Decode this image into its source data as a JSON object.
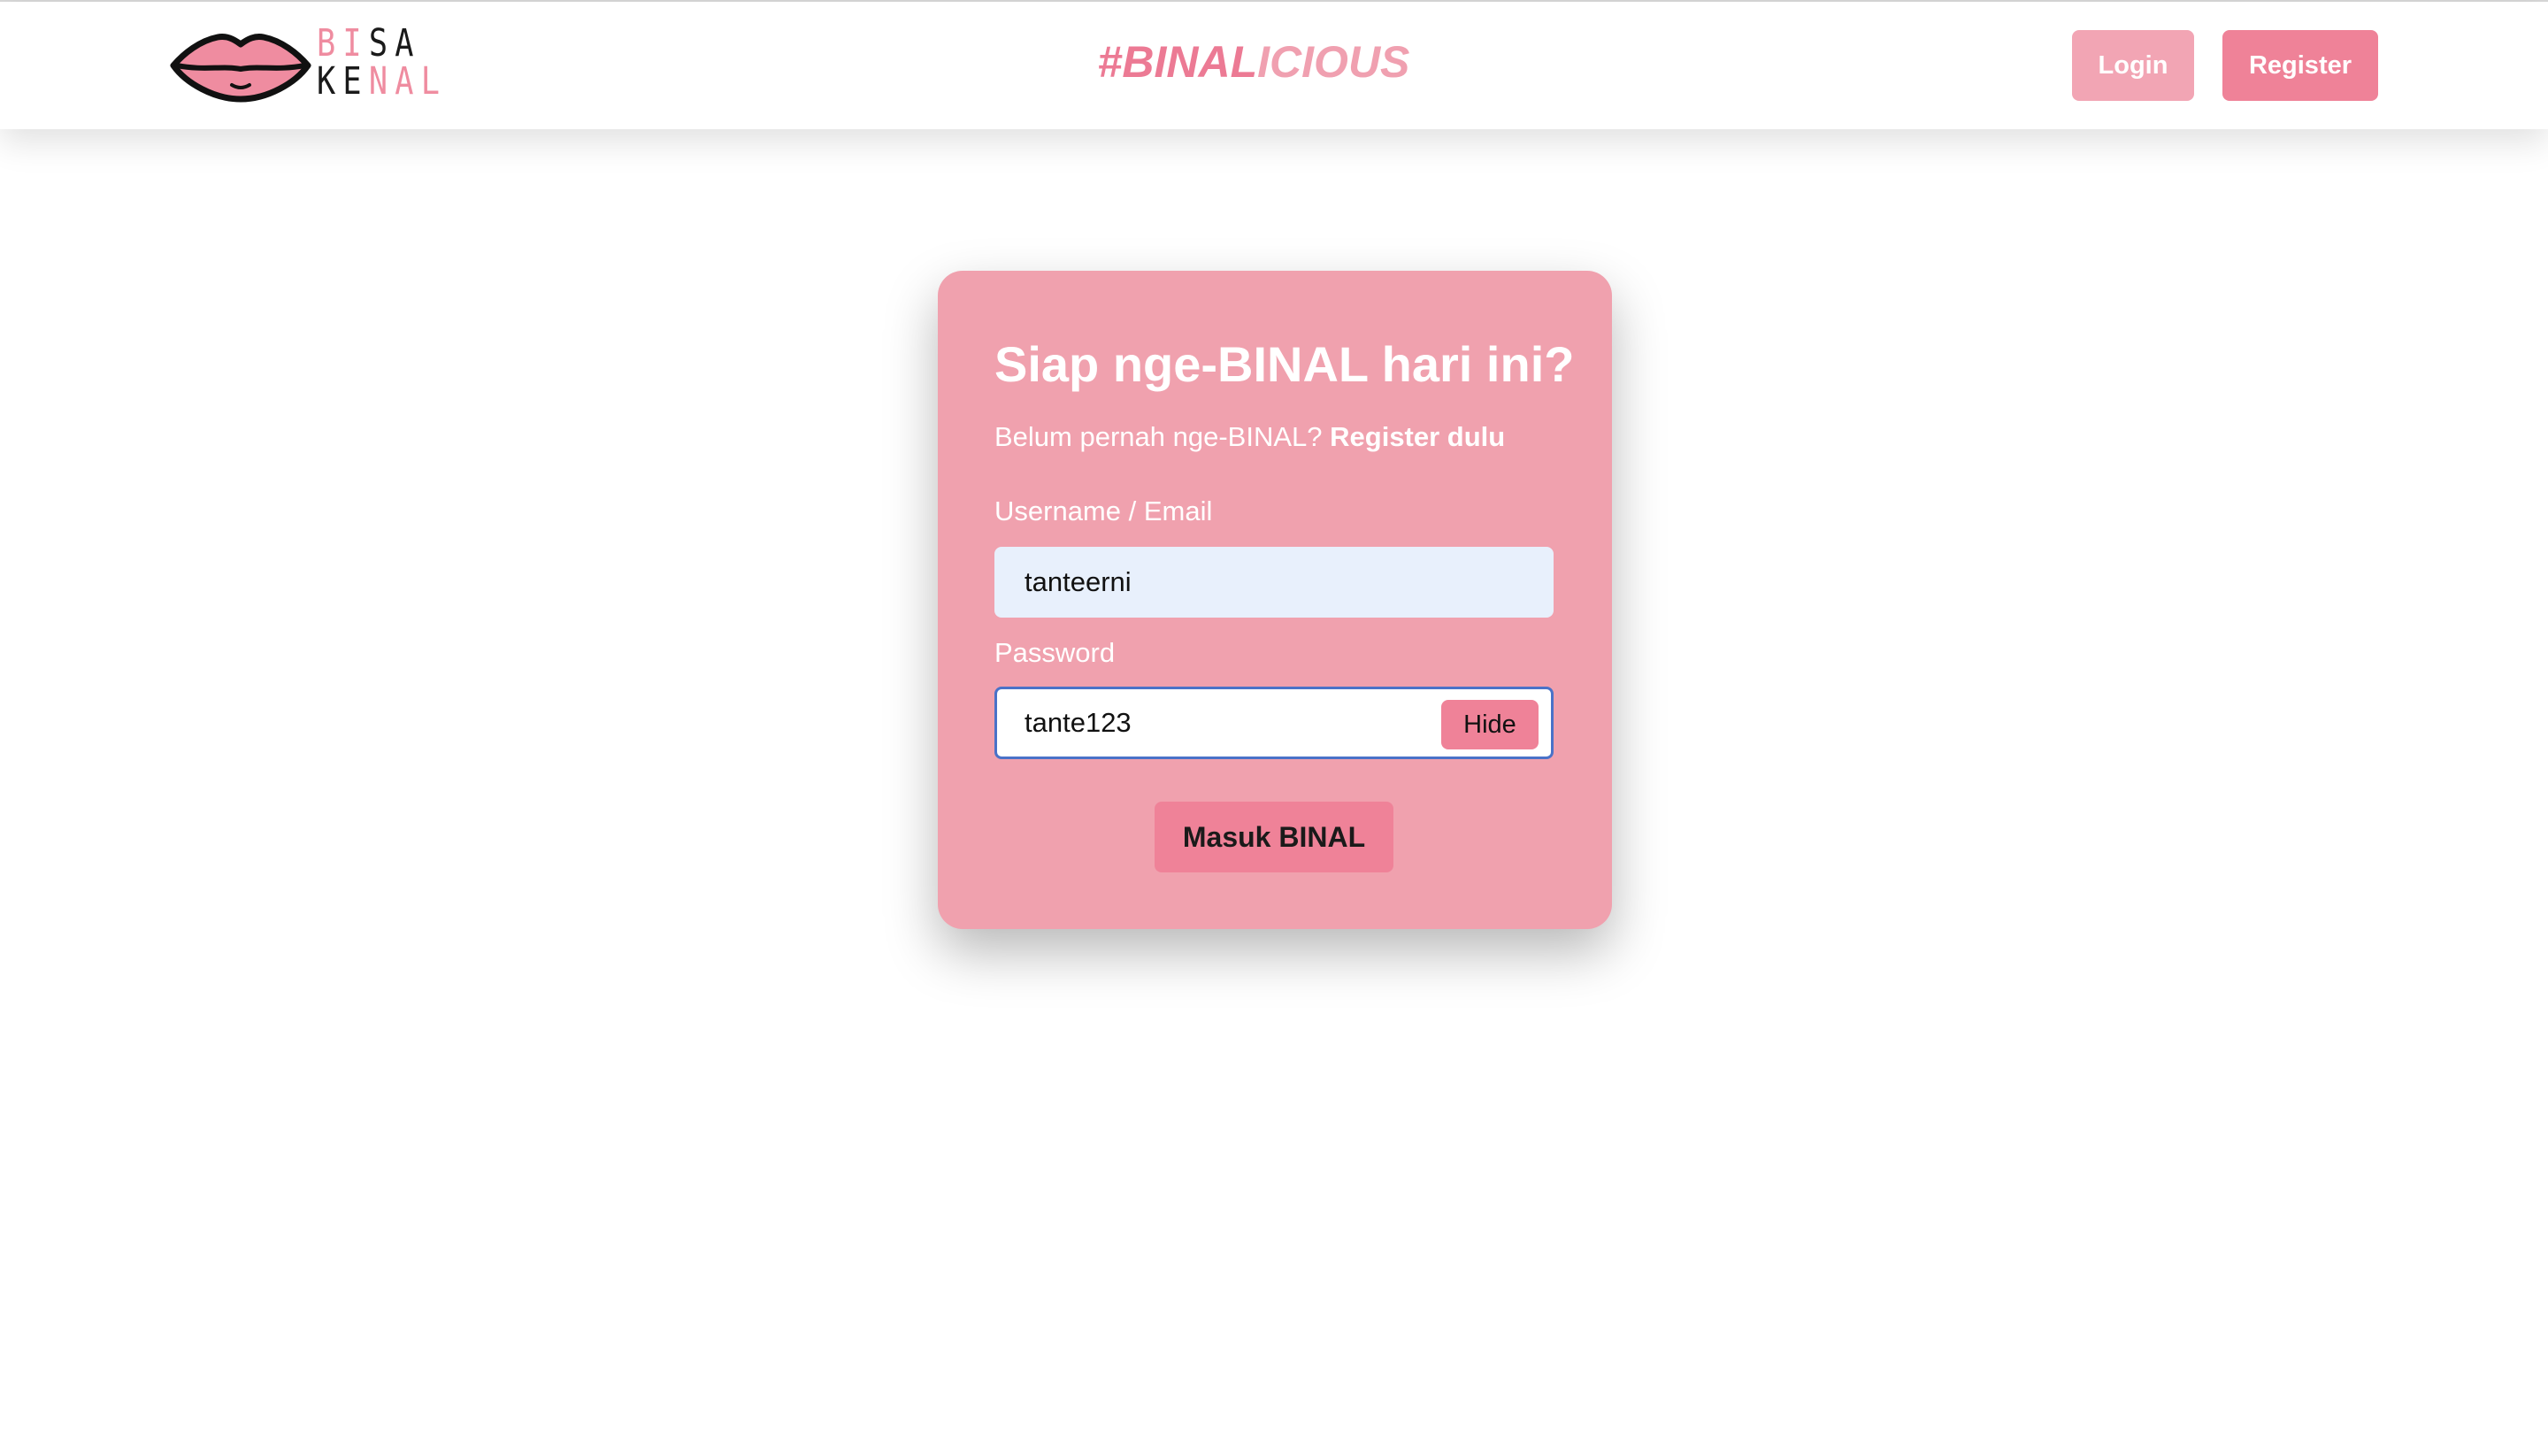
{
  "brand": {
    "logo_icon": "lips-icon",
    "logo_line1_part1": "BI",
    "logo_line1_part2": "SA",
    "logo_line2_part1": "KE",
    "logo_line2_part2": "NAL",
    "tagline_part1": "#BINAL",
    "tagline_part2": "ICIOUS"
  },
  "nav": {
    "login_label": "Login",
    "register_label": "Register"
  },
  "form": {
    "title": "Siap nge-BINAL hari ini?",
    "subtitle_prefix": "Belum pernah nge-BINAL?",
    "register_link": "Register dulu",
    "username_label": "Username / Email",
    "username_value": "tanteerni",
    "password_label": "Password",
    "password_value": "tante123",
    "toggle_label": "Hide",
    "submit_label": "Masuk BINAL"
  },
  "colors": {
    "primary_pink": "#ef8298",
    "light_pink": "#f2a5b4",
    "card_pink": "#f0a1ae",
    "input_bg": "#e8f0fc",
    "focus_border": "#4a72c8"
  }
}
